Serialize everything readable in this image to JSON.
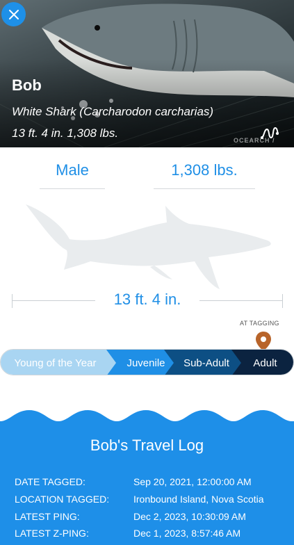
{
  "hero": {
    "name": "Bob",
    "species": "White Shark (Carcharodon carcharias)",
    "size_text": "13 ft. 4 in. 1,308 lbs.",
    "logo_text": "OCEARCH /",
    "close_icon": "close-icon",
    "track_icon": "squiggle-icon"
  },
  "stats": {
    "gender": "Male",
    "weight": "1,308 lbs.",
    "length": "13 ft. 4 in."
  },
  "stage_marker": {
    "label": "AT TAGGING",
    "icon": "map-pin-icon",
    "color": "#b8642a"
  },
  "stages": [
    {
      "label": "Young of the Year",
      "color": "#a9d5f2"
    },
    {
      "label": "Juvenile",
      "color": "#1f8fe6"
    },
    {
      "label": "Sub-Adult",
      "color": "#0d4f84"
    },
    {
      "label": "Adult",
      "color": "#0b2340"
    }
  ],
  "travel_log": {
    "title": "Bob's Travel Log",
    "rows": [
      {
        "key": "DATE TAGGED:",
        "value": "Sep 20, 2021, 12:00:00 AM"
      },
      {
        "key": "LOCATION TAGGED:",
        "value": "Ironbound Island, Nova Scotia"
      },
      {
        "key": "LATEST PING:",
        "value": "Dec 2, 2023, 10:30:09 AM"
      },
      {
        "key": "LATEST Z-PING:",
        "value": "Dec 1, 2023, 8:57:46 AM"
      }
    ]
  },
  "colors": {
    "accent": "#1f8fe6",
    "log_bg": "#1e8fe8"
  }
}
